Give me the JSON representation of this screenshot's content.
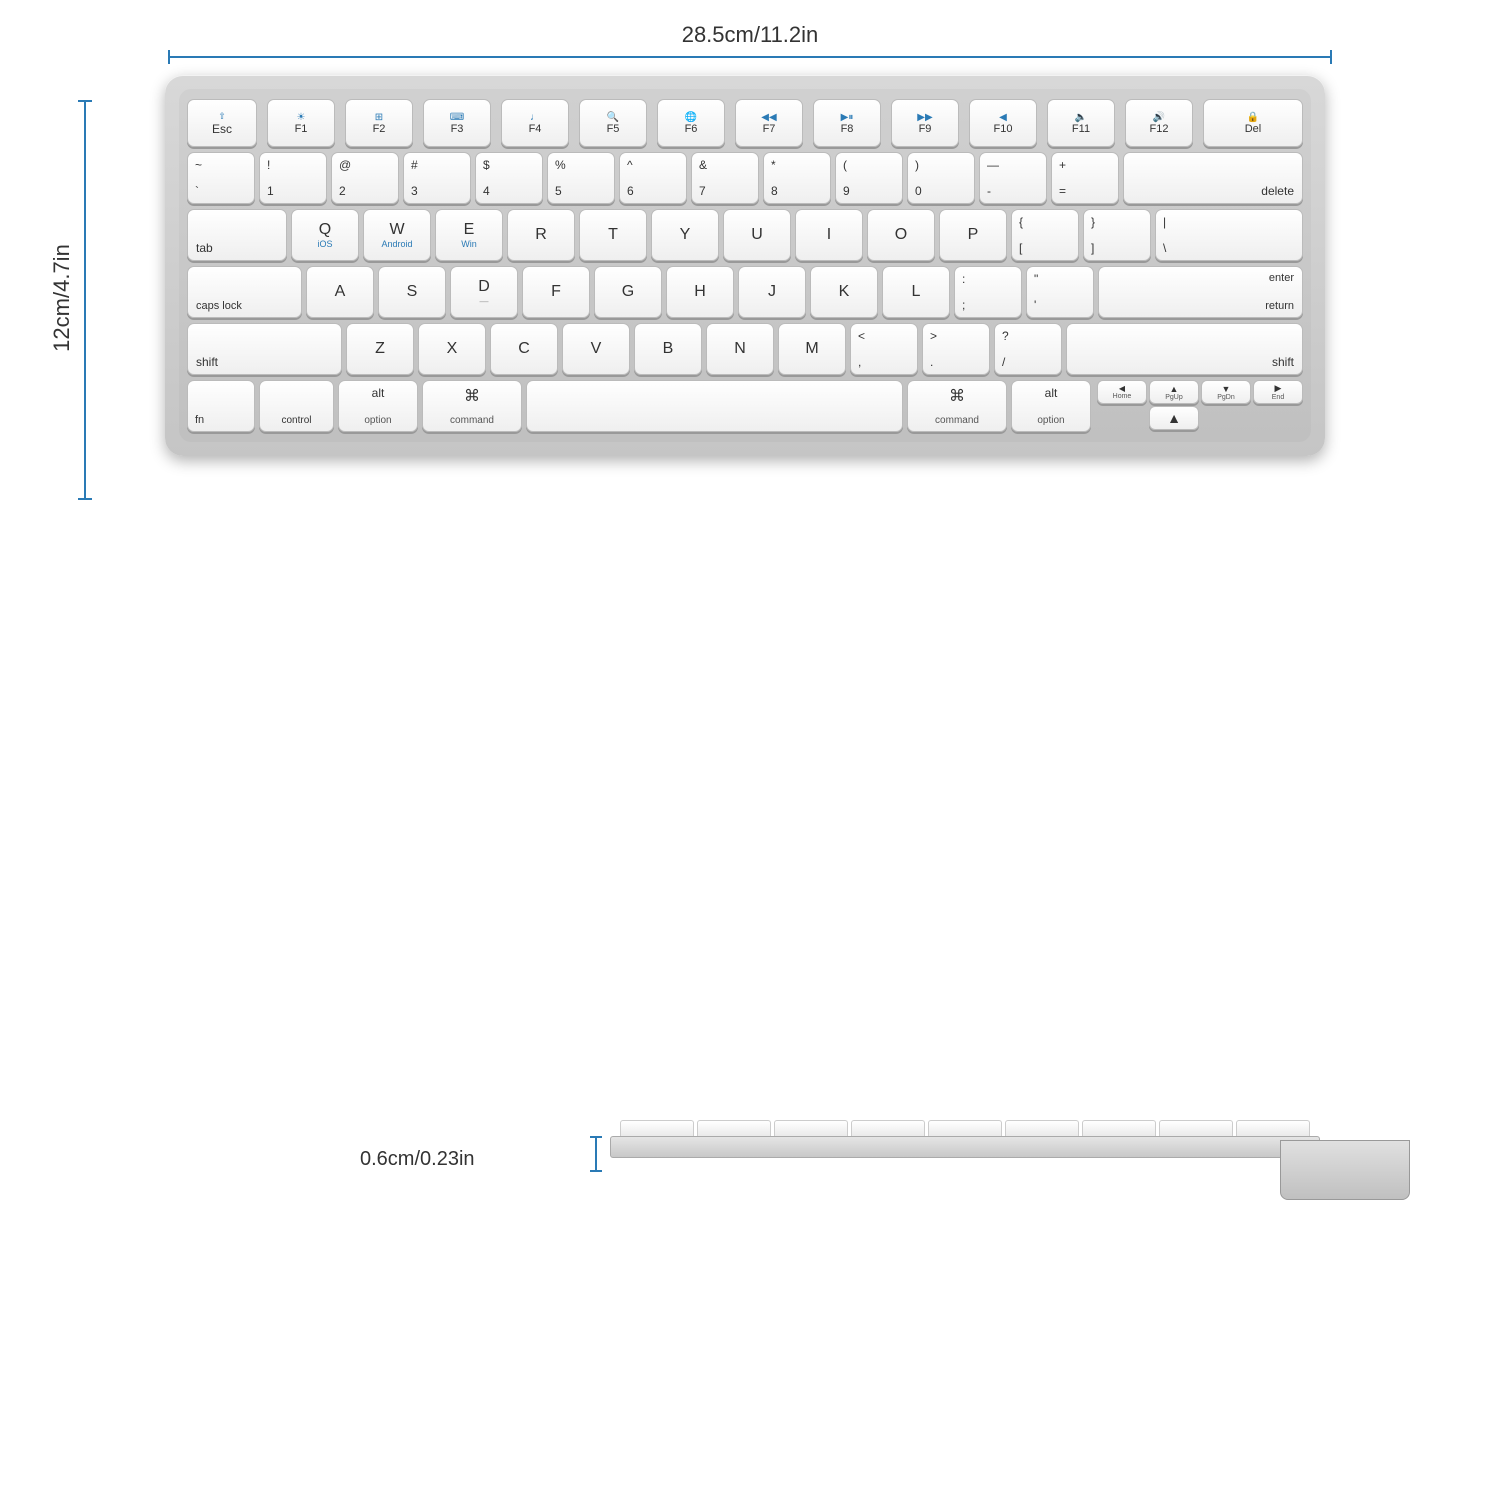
{
  "dimensions": {
    "width": "28.5cm/11.2in",
    "height": "12cm/4.7in",
    "thickness": "0.6cm/0.23in"
  },
  "keyboard": {
    "fn_row": [
      {
        "label": "Esc",
        "icon": "⇪",
        "sublabel": ""
      },
      {
        "label": "F1",
        "icon": "☀",
        "sublabel": ""
      },
      {
        "label": "F2",
        "icon": "⊞",
        "sublabel": ""
      },
      {
        "label": "F3",
        "icon": "⌨",
        "sublabel": ""
      },
      {
        "label": "F4",
        "icon": "♪",
        "sublabel": ""
      },
      {
        "label": "F5",
        "icon": "🔍",
        "sublabel": ""
      },
      {
        "label": "F6",
        "icon": "🌐",
        "sublabel": ""
      },
      {
        "label": "F7",
        "icon": "◀◀",
        "sublabel": ""
      },
      {
        "label": "F8",
        "icon": "▶▐",
        "sublabel": ""
      },
      {
        "label": "F9",
        "icon": "▶▶",
        "sublabel": ""
      },
      {
        "label": "F10",
        "icon": "◀",
        "sublabel": ""
      },
      {
        "label": "F11",
        "icon": "🔈",
        "sublabel": ""
      },
      {
        "label": "F12",
        "icon": "🔊",
        "sublabel": ""
      },
      {
        "label": "Del",
        "icon": "🔒",
        "sublabel": ""
      }
    ],
    "num_row": [
      {
        "top": "~",
        "bottom": "`"
      },
      {
        "top": "!",
        "bottom": "1"
      },
      {
        "top": "@",
        "bottom": "2"
      },
      {
        "top": "#",
        "bottom": "3"
      },
      {
        "top": "$",
        "bottom": "4"
      },
      {
        "top": "%",
        "bottom": "5"
      },
      {
        "top": "^",
        "bottom": "6"
      },
      {
        "top": "&",
        "bottom": "7"
      },
      {
        "top": "*",
        "bottom": "8"
      },
      {
        "top": "(",
        "bottom": "9"
      },
      {
        "top": ")",
        "bottom": "0"
      },
      {
        "top": "—",
        "bottom": "-"
      },
      {
        "top": "+",
        "bottom": "="
      },
      {
        "label": "delete"
      }
    ],
    "bottom_row": {
      "fn": "fn",
      "control": "control",
      "option_l": "option",
      "command_l": "command",
      "space": "",
      "command_r": "command",
      "option_r": "option",
      "home": "Home",
      "pgup": "PgUp",
      "pgdn": "PgDn",
      "end": "End",
      "left": "◀",
      "right": "▶",
      "up": "▲",
      "down": "▼"
    }
  }
}
